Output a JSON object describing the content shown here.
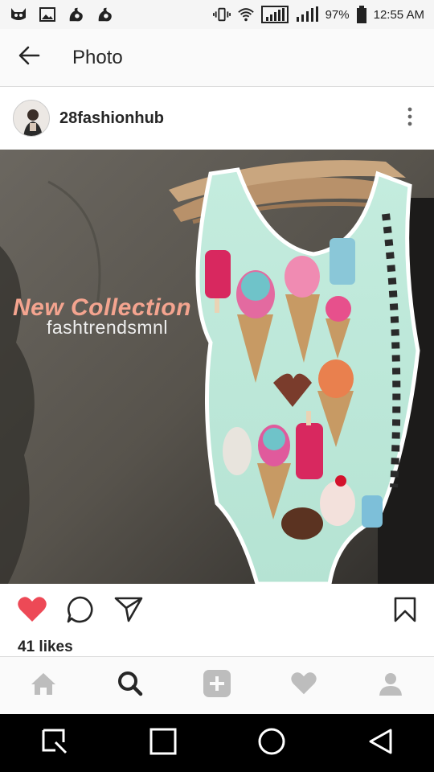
{
  "status_bar": {
    "notifications": [
      "cat-icon",
      "image-icon",
      "uc-browser-icon",
      "uc-browser-icon"
    ],
    "battery": "97%",
    "time": "12:55 AM"
  },
  "app_bar": {
    "title": "Photo"
  },
  "post": {
    "username": "28fashionhub",
    "overlay_title": "New Collection",
    "overlay_subtitle": "fashtrendsmnl",
    "likes": "41 likes"
  },
  "colors": {
    "like_red": "#ed4956",
    "bottom_nav_icon": "#bdbdbd",
    "bottom_nav_active": "#262626",
    "overlay_pink": "#f4a48f"
  },
  "bottom_nav": {
    "items": [
      "home-icon",
      "search-icon",
      "add-icon",
      "activity-icon",
      "profile-icon"
    ],
    "active": "search-icon"
  },
  "system_nav": {
    "items": [
      "recents-icon",
      "home-square-icon",
      "circle-home-icon",
      "back-triangle-icon"
    ]
  }
}
